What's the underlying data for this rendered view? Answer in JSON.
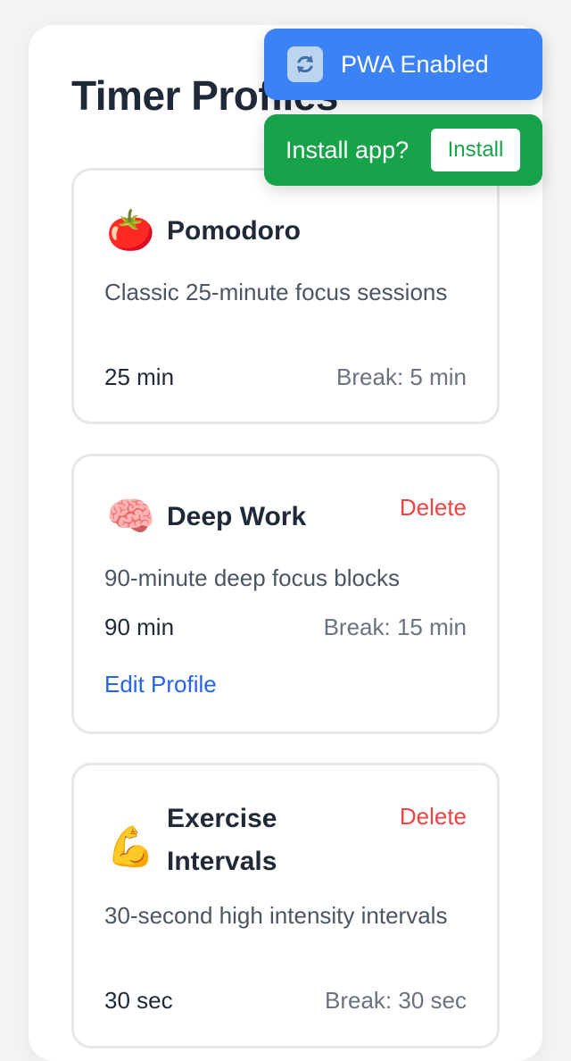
{
  "page": {
    "title": "Timer Profiles"
  },
  "profiles": [
    {
      "emoji": "🍅",
      "name": "Pomodoro",
      "description": "Classic 25-minute focus sessions",
      "duration": "25 min",
      "break": "Break: 5 min"
    },
    {
      "emoji": "🧠",
      "name": "Deep Work",
      "description": "90-minute deep focus blocks",
      "duration": "90 min",
      "break": "Break: 15 min",
      "delete_label": "Delete",
      "edit_label": "Edit Profile"
    },
    {
      "emoji": "💪",
      "name": "Exercise Intervals",
      "description": "30-second high intensity intervals",
      "duration": "30 sec",
      "break": "Break: 30 sec",
      "delete_label": "Delete"
    }
  ],
  "toasts": {
    "pwa": {
      "icon": "sync-icon",
      "text": "PWA Enabled",
      "color": "#3b82f6"
    },
    "install": {
      "text": "Install app?",
      "button_label": "Install",
      "color": "#16a34a"
    }
  },
  "colors": {
    "danger": "#ef4444",
    "link": "#2563eb",
    "title": "#1f2937"
  }
}
